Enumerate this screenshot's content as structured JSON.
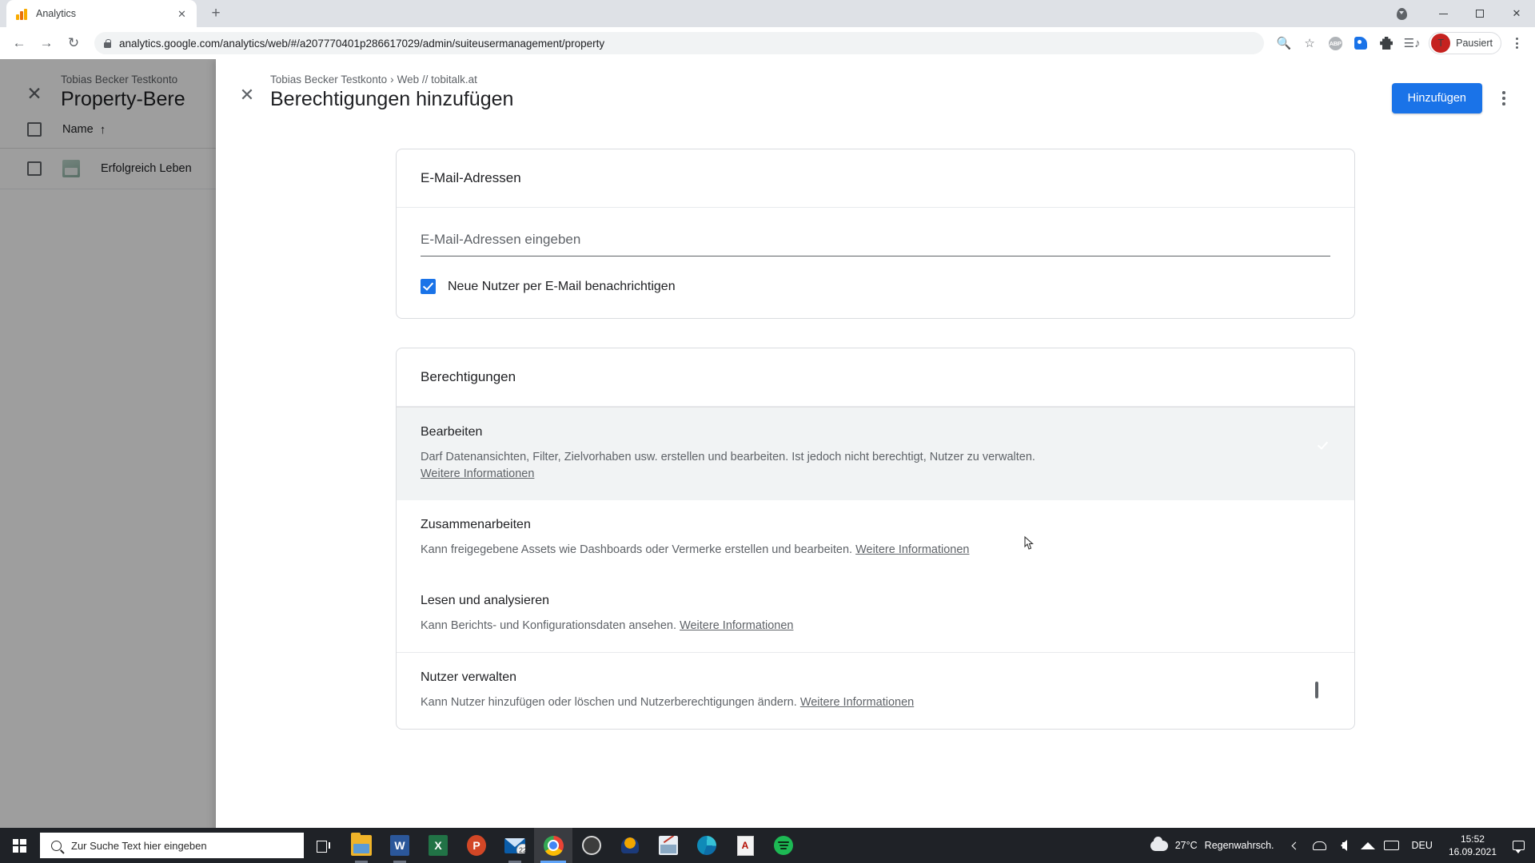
{
  "browser": {
    "tab": {
      "title": "Analytics",
      "favicon": "analytics-bars-icon",
      "close_label": "✕"
    },
    "new_tab_label": "+",
    "nav": {
      "back": "←",
      "forward": "→",
      "reload": "↻"
    },
    "url": "analytics.google.com/analytics/web/#/a207770401p286617029/admin/suiteusermanagement/property",
    "toolbar_icons": [
      "zoom-icon",
      "bookmark-star-icon",
      "adblock-plus-icon",
      "blue-tag-icon",
      "extensions-puzzle-icon",
      "reading-list-icon"
    ],
    "abp_label": "ABP",
    "profile": {
      "initial": "T",
      "status": "Pausiert"
    },
    "window_controls": {
      "minimize": "–",
      "maximize": "❐",
      "close": "✕"
    }
  },
  "background_page": {
    "close_label": "✕",
    "breadcrumb": "Tobias Becker Testkonto",
    "title": "Property-Bere",
    "column_name": "Name",
    "sort_arrow": "↑",
    "rows": [
      {
        "name": "Erfolgreich Leben"
      }
    ]
  },
  "overlay": {
    "close_label": "✕",
    "breadcrumb_account": "Tobias Becker Testkonto",
    "breadcrumb_sep": "›",
    "breadcrumb_property": "Web // tobitalk.at",
    "title": "Berechtigungen hinzufügen",
    "primary_button": "Hinzufügen",
    "more_menu": "more-options-icon"
  },
  "email_card": {
    "heading": "E-Mail-Adressen",
    "input_value": "",
    "input_placeholder": "E-Mail-Adressen eingeben",
    "notify_checkbox_label": "Neue Nutzer per E-Mail benachrichtigen",
    "notify_checked": true
  },
  "permissions_card": {
    "heading": "Berechtigungen",
    "learn_more": "Weitere Informationen",
    "rows": [
      {
        "title": "Bearbeiten",
        "description": "Darf Datenansichten, Filter, Zielvorhaben usw. erstellen und bearbeiten. Ist jedoch nicht berechtigt, Nutzer zu verwalten.",
        "link": "Weitere Informationen",
        "link_inline": false,
        "checked": true,
        "shaded": true
      },
      {
        "title": "Zusammenarbeiten",
        "description": "Kann freigegebene Assets wie Dashboards oder Vermerke erstellen und bearbeiten.",
        "link": "Weitere Informationen",
        "link_inline": true,
        "checked": true,
        "shaded": false
      },
      {
        "title": "Lesen und analysieren",
        "description": "Kann Berichts- und Konfigurationsdaten ansehen.",
        "link": "Weitere Informationen",
        "link_inline": true,
        "checked": true,
        "shaded": false
      },
      {
        "title": "Nutzer verwalten",
        "description": "Kann Nutzer hinzufügen oder löschen und Nutzerberechtigungen ändern.",
        "link": "Weitere Informationen",
        "link_inline": true,
        "checked": false,
        "shaded": false
      }
    ]
  },
  "taskbar": {
    "start_label": "start-windows-icon",
    "search_placeholder": "Zur Suche Text hier eingeben",
    "task_view": "task-view-icon",
    "apps": [
      {
        "name": "file-explorer",
        "label": "Datei-Explorer"
      },
      {
        "name": "word",
        "label": "W"
      },
      {
        "name": "excel",
        "label": "X"
      },
      {
        "name": "powerpoint",
        "label": "P"
      },
      {
        "name": "mail",
        "label": "Mail",
        "badge": "22"
      },
      {
        "name": "chrome",
        "label": "Google Chrome"
      },
      {
        "name": "obs",
        "label": "OBS"
      },
      {
        "name": "headset-app",
        "label": "Headset"
      },
      {
        "name": "photo-editor",
        "label": "Foto"
      },
      {
        "name": "edge",
        "label": "Microsoft Edge"
      },
      {
        "name": "acrobat",
        "label": "A"
      },
      {
        "name": "spotify",
        "label": "Spotify"
      }
    ],
    "weather": {
      "temperature": "27°C",
      "condition": "Regenwahrsch."
    },
    "language": "DEU",
    "time": "15:52",
    "date": "16.09.2021",
    "tray_icons": [
      "chevron-up-icon",
      "onedrive-icon",
      "volume-icon",
      "wifi-icon",
      "keyboard-icon",
      "action-center-icon"
    ]
  },
  "colors": {
    "accent": "#1a73e8",
    "taskbar": "#1f2227",
    "chrome_tabstrip": "#dee1e6",
    "shaded_row": "#f1f3f4"
  }
}
